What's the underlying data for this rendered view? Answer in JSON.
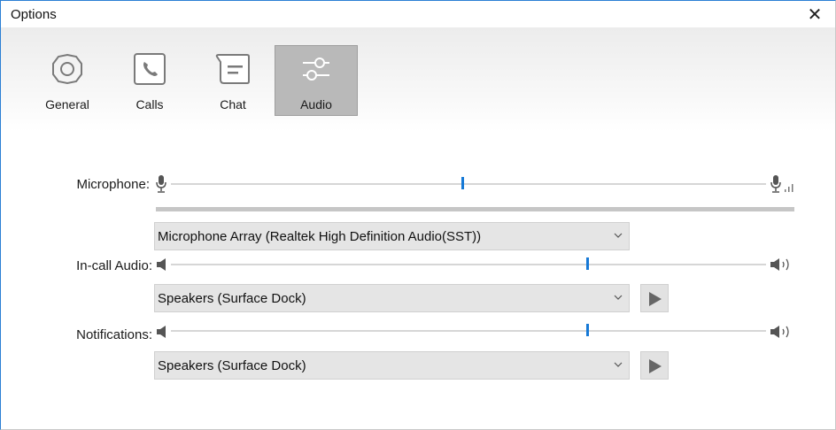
{
  "window": {
    "title": "Options",
    "close_symbol": "✕"
  },
  "tabs": [
    {
      "label": "General",
      "icon": "gear-icon"
    },
    {
      "label": "Calls",
      "icon": "phone-icon"
    },
    {
      "label": "Chat",
      "icon": "chat-bubble-icon"
    },
    {
      "label": "Audio",
      "icon": "audio-sliders-icon",
      "selected": true
    }
  ],
  "audio": {
    "microphone": {
      "label": "Microphone:",
      "level": 0.49,
      "device": "Microphone Array (Realtek High Definition Audio(SST))"
    },
    "in_call_audio": {
      "label": "In-call Audio:",
      "level": 0.7,
      "device": "Speakers (Surface Dock)"
    },
    "notifications": {
      "label": "Notifications:",
      "level": 0.7,
      "device": "Speakers (Surface Dock)"
    }
  },
  "colors": {
    "accent": "#1679d6",
    "selected_tab": "#b9b9b9"
  }
}
